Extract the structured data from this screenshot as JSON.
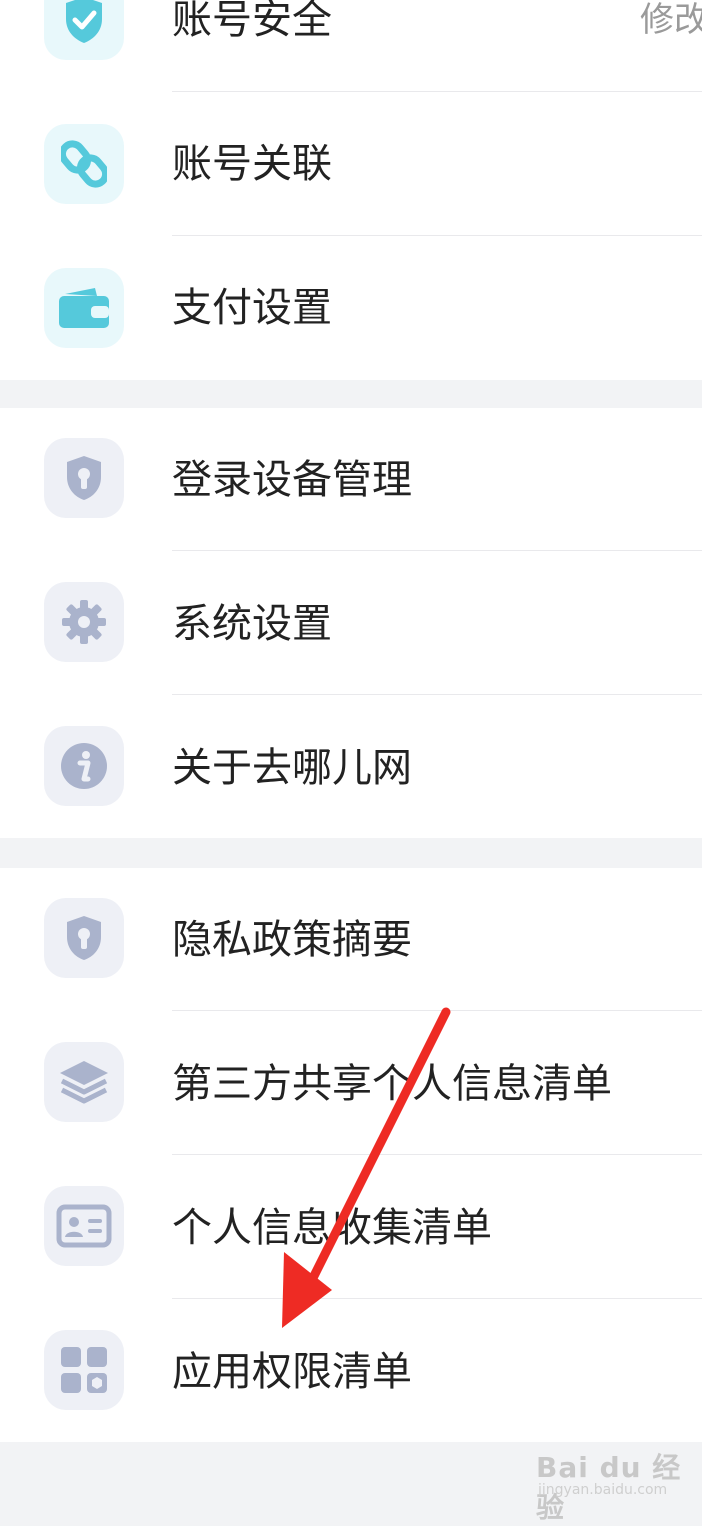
{
  "sections": [
    {
      "items": [
        {
          "label": "账号安全",
          "icon": "shield-check-icon",
          "right_text": "修改"
        },
        {
          "label": "账号关联",
          "icon": "link-icon"
        },
        {
          "label": "支付设置",
          "icon": "wallet-icon"
        }
      ]
    },
    {
      "items": [
        {
          "label": "登录设备管理",
          "icon": "shield-lock-icon"
        },
        {
          "label": "系统设置",
          "icon": "gear-icon"
        },
        {
          "label": "关于去哪儿网",
          "icon": "info-icon"
        }
      ]
    },
    {
      "items": [
        {
          "label": "隐私政策摘要",
          "icon": "shield-lock-icon"
        },
        {
          "label": "第三方共享个人信息清单",
          "icon": "layers-icon"
        },
        {
          "label": "个人信息收集清单",
          "icon": "id-card-icon"
        },
        {
          "label": "应用权限清单",
          "icon": "apps-grid-icon"
        }
      ]
    }
  ],
  "colors": {
    "teal_icon": "#55c9db",
    "teal_bg": "#e8f8fb",
    "gray_icon": "#aab3cc",
    "gray_bg": "#eef0f6",
    "arrow": "#ee2b24"
  },
  "watermark": {
    "main": "Bai du 经验",
    "sub": "jingyan.baidu.com"
  }
}
